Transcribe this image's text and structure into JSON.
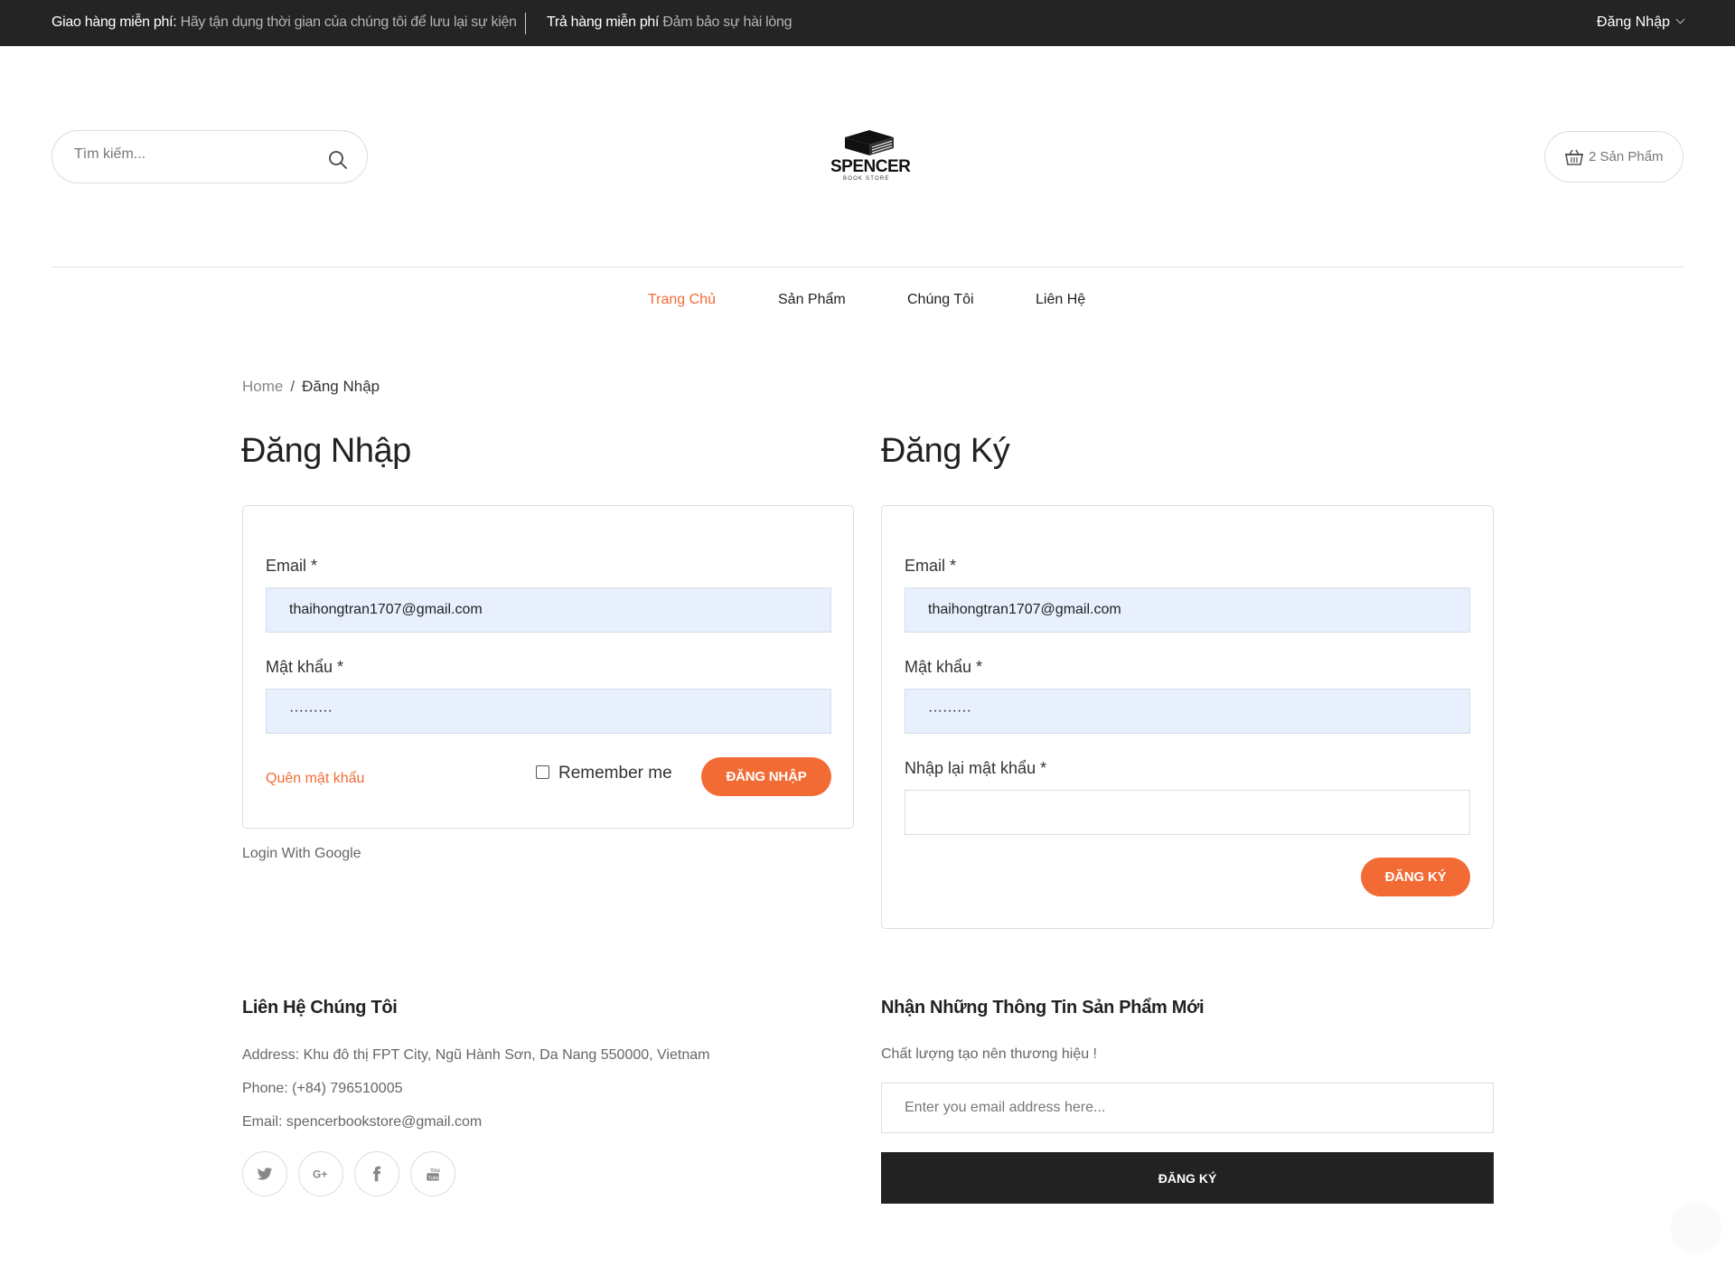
{
  "topbar": {
    "shipping_title": "Giao hàng miễn phí:",
    "shipping_text": "Hãy tận dụng thời gian của chúng tôi để lưu lại sự kiện",
    "return_title": "Trả hàng miễn phí",
    "return_text": "Đảm bảo sự hài lòng",
    "login_label": "Đăng Nhập"
  },
  "header": {
    "search_placeholder": "Tìm kiếm...",
    "logo_name": "SPENCER",
    "logo_tagline": "BOOK STORE",
    "cart_label": "2 Sản Phẩm"
  },
  "nav": {
    "items": [
      "Trang Chủ",
      "Sản Phẩm",
      "Chúng Tôi",
      "Liên Hệ"
    ],
    "active_color": "#f26b35"
  },
  "breadcrumb": {
    "home": "Home",
    "separator": "/",
    "current": "Đăng Nhập"
  },
  "login": {
    "title": "Đăng Nhập",
    "email_label": "Email *",
    "email_value": "thaihongtran1707@gmail.com",
    "password_label": "Mật khẩu *",
    "password_value": "·········",
    "forgot_label": "Quên mật khẩu",
    "remember_label": "Remember me",
    "submit_label": "ĐĂNG NHẬP",
    "google_label": "Login With Google"
  },
  "register": {
    "title": "Đăng Ký",
    "email_label": "Email *",
    "email_value": "thaihongtran1707@gmail.com",
    "password_label": "Mật khẩu *",
    "password_value": "·········",
    "confirm_label": "Nhập lại mật khẩu *",
    "confirm_value": "",
    "submit_label": "ĐĂNG KÝ"
  },
  "footer": {
    "contact_title": "Liên Hệ Chúng Tôi",
    "address": "Address: Khu đô thị FPT City, Ngũ Hành Sơn, Da Nang 550000, Vietnam",
    "phone": "Phone: (+84) 796510005",
    "email": "Email: spencerbookstore@gmail.com",
    "social_icons": [
      "twitter-icon",
      "google-plus-icon",
      "facebook-icon",
      "youtube-icon"
    ],
    "newsletter_title": "Nhận Những Thông Tin Sản Phẩm Mới",
    "newsletter_subtitle": "Chất lượng tạo nên thương hiệu !",
    "newsletter_placeholder": "Enter you email address here...",
    "newsletter_button": "ĐĂNG KÝ"
  },
  "colors": {
    "accent": "#f26b35",
    "topbar_bg": "#242424",
    "autofill_bg": "#e8f0fe"
  }
}
